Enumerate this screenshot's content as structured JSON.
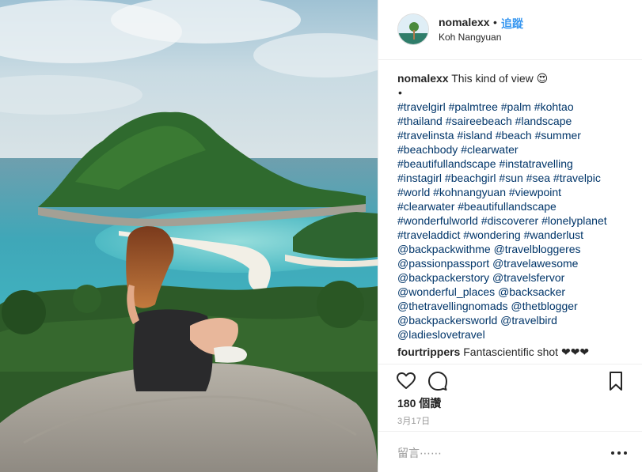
{
  "post": {
    "username": "nomalexx",
    "follow_separator": "•",
    "follow_label": "追蹤",
    "location": "Koh Nangyuan",
    "caption": {
      "username": "nomalexx",
      "text": "This kind of view",
      "emoji": "😍",
      "bullet": "•",
      "tag_lines": [
        [
          "#travelgirl",
          "#palmtree",
          "#palm",
          "#kohtao"
        ],
        [
          "#thailand",
          "#saireebeach",
          "#landscape"
        ],
        [
          "#travelinsta",
          "#island",
          "#beach",
          "#summer"
        ],
        [
          "#beachbody",
          "#clearwater"
        ],
        [
          "#beautifullandscape",
          "#instatravelling"
        ],
        [
          "#instagirl",
          "#beachgirl",
          "#sun",
          "#sea",
          "#travelpic"
        ],
        [
          "#world",
          "#kohnangyuan",
          "#viewpoint"
        ],
        [
          "#clearwater",
          "#beautifullandscape"
        ],
        [
          "#wonderfulworld",
          "#discoverer",
          "#lonelyplanet"
        ],
        [
          "#traveladdict",
          "#wondering",
          "#wanderlust"
        ],
        [
          "@backpackwithme",
          "@travelbloggeres"
        ],
        [
          "@passionpassport",
          "@travelawesome"
        ],
        [
          "@backpackerstory",
          "@travelsfervor"
        ],
        [
          "@wonderful_places",
          "@backsacker"
        ],
        [
          "@thetravellingnomads",
          "@thetblogger"
        ],
        [
          "@backpackersworld",
          "@travelbird"
        ],
        [
          "@ladieslovetravel"
        ]
      ]
    },
    "comments": [
      {
        "username": "fourtrippers",
        "text": "Fantascientific shot ❤❤❤"
      }
    ],
    "likes_label": "180 個讚",
    "date_label": "3月17日",
    "add_comment_placeholder": "留言⋯⋯",
    "icons": [
      "heart-icon",
      "comment-icon",
      "bookmark-icon",
      "more-options-icon"
    ]
  }
}
